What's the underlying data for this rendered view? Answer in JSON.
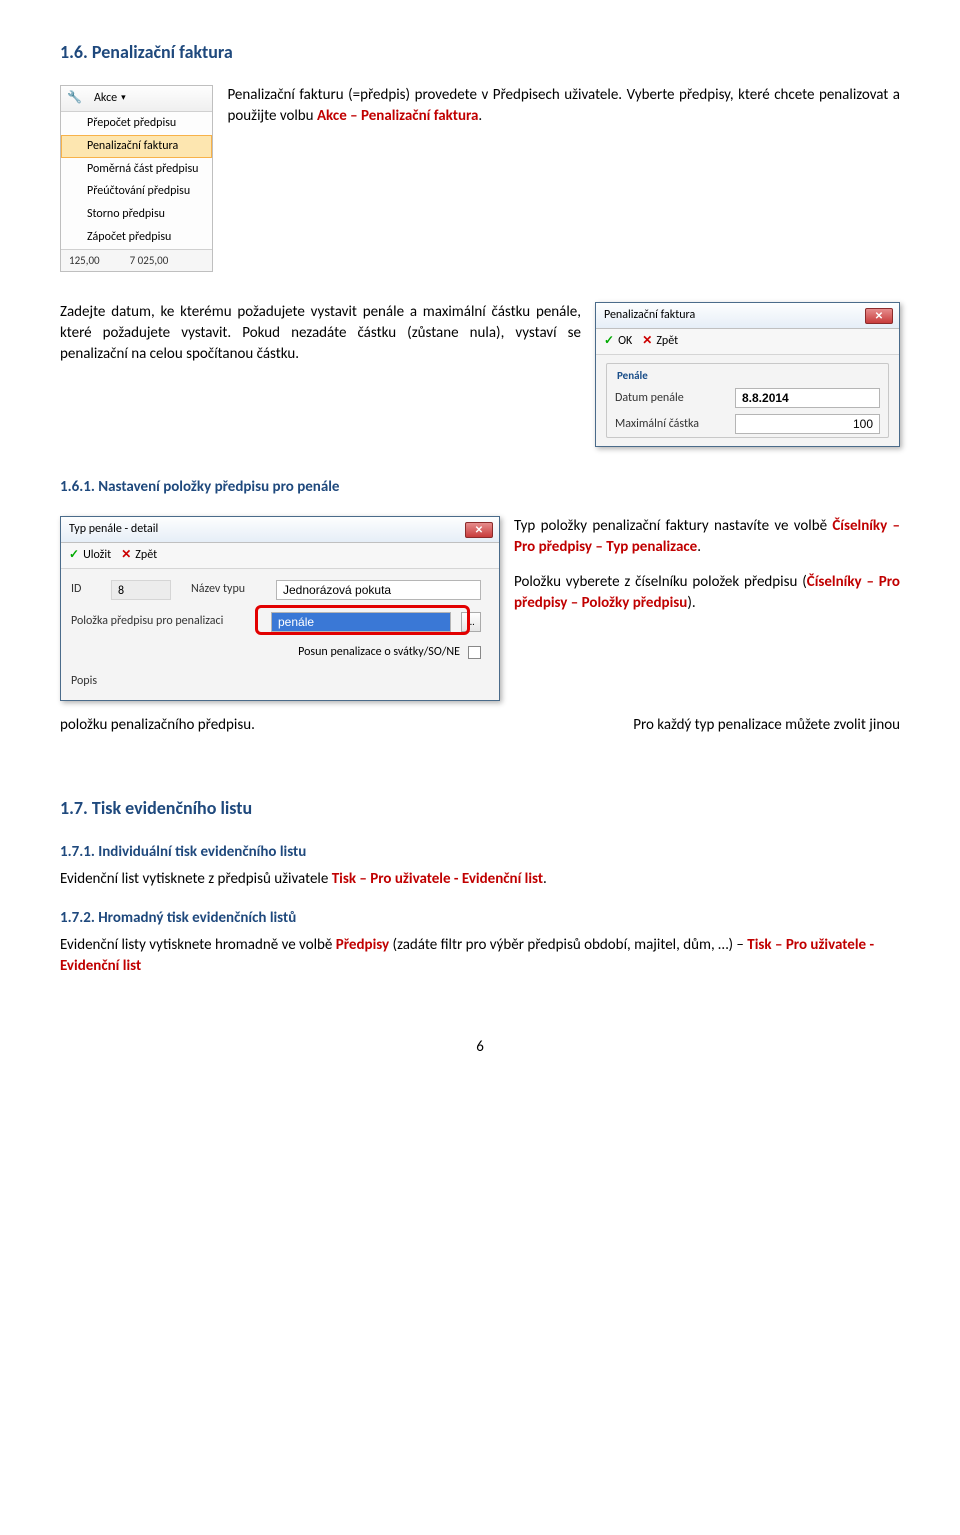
{
  "h1_6": "1.6. Penalizační faktura",
  "intro": {
    "t1": "Penalizační fakturu (=předpis) provedete v Předpisech uživatele. Vyberte předpisy, které chcete penalizovat a použijte volbu ",
    "akce": "Akce – Penalizační faktura",
    "dot": "."
  },
  "akce_menu": {
    "button": "Akce",
    "items": [
      "Přepočet předpisu",
      "Penalizační faktura",
      "Poměrná část předpisu",
      "Přeúčtování předpisu",
      "Storno předpisu",
      "Zápočet předpisu"
    ],
    "footer_a": "125,00",
    "footer_b": "7 025,00"
  },
  "mid_para": "Zadejte datum, ke kterému požadujete vystavit penále a maximální částku penále, které požadujete vystavit. Pokud nezadáte částku (zůstane nula), vystaví se penalizační na celou spočítanou částku.",
  "penale_dialog": {
    "title": "Penalizační faktura",
    "ok": "OK",
    "back": "Zpět",
    "group": "Penále",
    "l_date": "Datum penále",
    "v_date": "8.8.2014",
    "l_max": "Maximální částka",
    "v_max": "100"
  },
  "h1_6_1": "1.6.1. Nastavení položky předpisu pro penále",
  "typ_dialog": {
    "title": "Typ penále - detail",
    "save": "Uložit",
    "back": "Zpět",
    "l_id": "ID",
    "v_id": "8",
    "l_name": "Název typu",
    "v_name": "Jednorázová pokuta",
    "l_item": "Položka předpisu pro penalizaci",
    "v_item": "penále",
    "l_shift": "Posun penalizace o svátky/SO/NE",
    "l_popis": "Popis"
  },
  "right_block": {
    "p1a": "Typ položky penalizační faktury nastavíte ve volbě ",
    "p1b": "Číselníky – Pro předpisy – Typ penalizace",
    "p1c": ".",
    "p2a": "Položku vyberete z číselníku položek předpisu (",
    "p2b": "Číselníky – Pro předpisy – Položky předpisu",
    "p2c": ")."
  },
  "lower": {
    "left": "položku penalizačního předpisu.",
    "right": "Pro každý typ penalizace můžete zvolit jinou"
  },
  "h1_7": "1.7. Tisk evidenčního listu",
  "h1_7_1": "1.7.1. Individuální tisk evidenčního listu",
  "p1_7_1": {
    "a": "Evidenční list vytisknete z předpisů uživatele ",
    "b": "Tisk – Pro uživatele - Evidenční list",
    "c": "."
  },
  "h1_7_2": "1.7.2. Hromadný tisk evidenčních listů",
  "p1_7_2": {
    "a": "Evidenční listy vytisknete hromadně ve volbě ",
    "b": "Předpisy",
    "c": " (zadáte filtr pro výběr předpisů období, majitel, dům, …) – ",
    "d": "Tisk – Pro uživatele - Evidenční list"
  },
  "pagenum": "6"
}
